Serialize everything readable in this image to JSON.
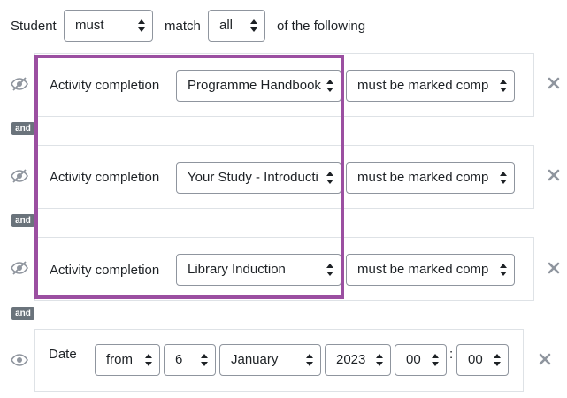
{
  "header": {
    "student_label": "Student",
    "must_value": "must",
    "match_label": "match",
    "all_value": "all",
    "following_label": "of the following"
  },
  "conditions": [
    {
      "type_label": "Activity completion",
      "activity": "Programme Handbook",
      "requirement": "must be marked comp"
    },
    {
      "type_label": "Activity completion",
      "activity": "Your Study - Introducti",
      "requirement": "must be marked comp"
    },
    {
      "type_label": "Activity completion",
      "activity": "Library Induction",
      "requirement": "must be marked comp"
    }
  ],
  "and_label": "and",
  "date_condition": {
    "label": "Date",
    "direction": "from",
    "day": "6",
    "month": "January",
    "year": "2023",
    "hour": "00",
    "separator": ":",
    "minute": "00"
  },
  "icons": {
    "eye_hidden": "eye-slash-icon",
    "eye": "eye-icon",
    "delete": "delete-x-icon",
    "caret": "select-caret-icon"
  },
  "colors": {
    "highlight": "#9b4fa1",
    "badge": "#6a737b",
    "border": "#dee2e6",
    "icon": "#8f959e"
  }
}
